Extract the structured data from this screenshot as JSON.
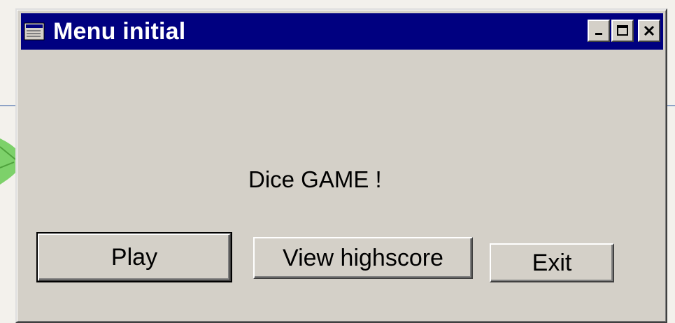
{
  "window": {
    "title": "Menu initial",
    "controls": {
      "minimize_icon": "minimize-icon",
      "maximize_icon": "maximize-icon",
      "close_icon": "close-icon"
    }
  },
  "content": {
    "heading": "Dice GAME !",
    "buttons": {
      "play": "Play",
      "highscore": "View highscore",
      "exit": "Exit"
    }
  },
  "colors": {
    "titlebar": "#000080",
    "face": "#d4d0c8",
    "background": "#f3f1ec"
  }
}
